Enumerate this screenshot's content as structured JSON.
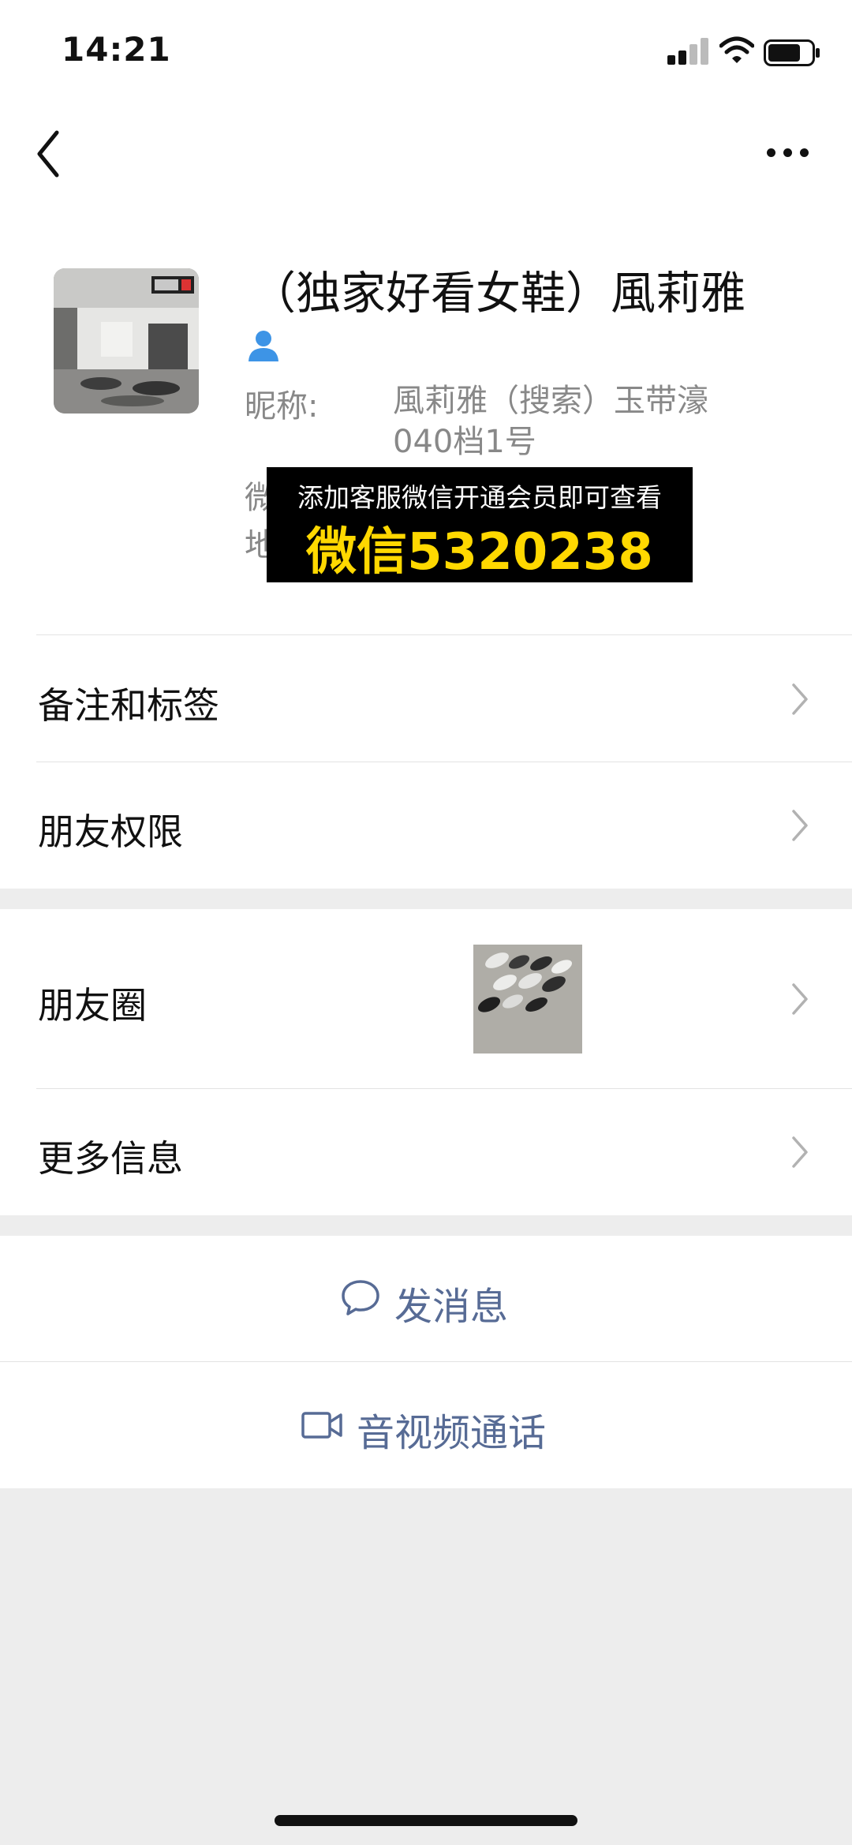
{
  "status_bar": {
    "time": "14:21"
  },
  "profile": {
    "name": "（独家好看女鞋）風莉雅",
    "nickname_label": "昵称:",
    "nickname_value": "風莉雅（搜索）玉带濠040档1号",
    "hidden_label_1": "微",
    "hidden_label_2": "地"
  },
  "promo": {
    "line1": "添加客服微信开通会员即可查看",
    "line2": "微信5320238",
    "accent_color": "#ffd800"
  },
  "menu": {
    "remarks_tags": "备注和标签",
    "friend_permissions": "朋友权限",
    "moments": "朋友圈",
    "more_info": "更多信息"
  },
  "actions": {
    "send_message": "发消息",
    "video_call": "音视频通话",
    "link_color": "#576b95"
  },
  "icons": {
    "back": "chevron-left-icon",
    "more": "more-dots-icon",
    "user": "user-icon",
    "message": "chat-bubble-icon",
    "video": "video-camera-icon"
  }
}
